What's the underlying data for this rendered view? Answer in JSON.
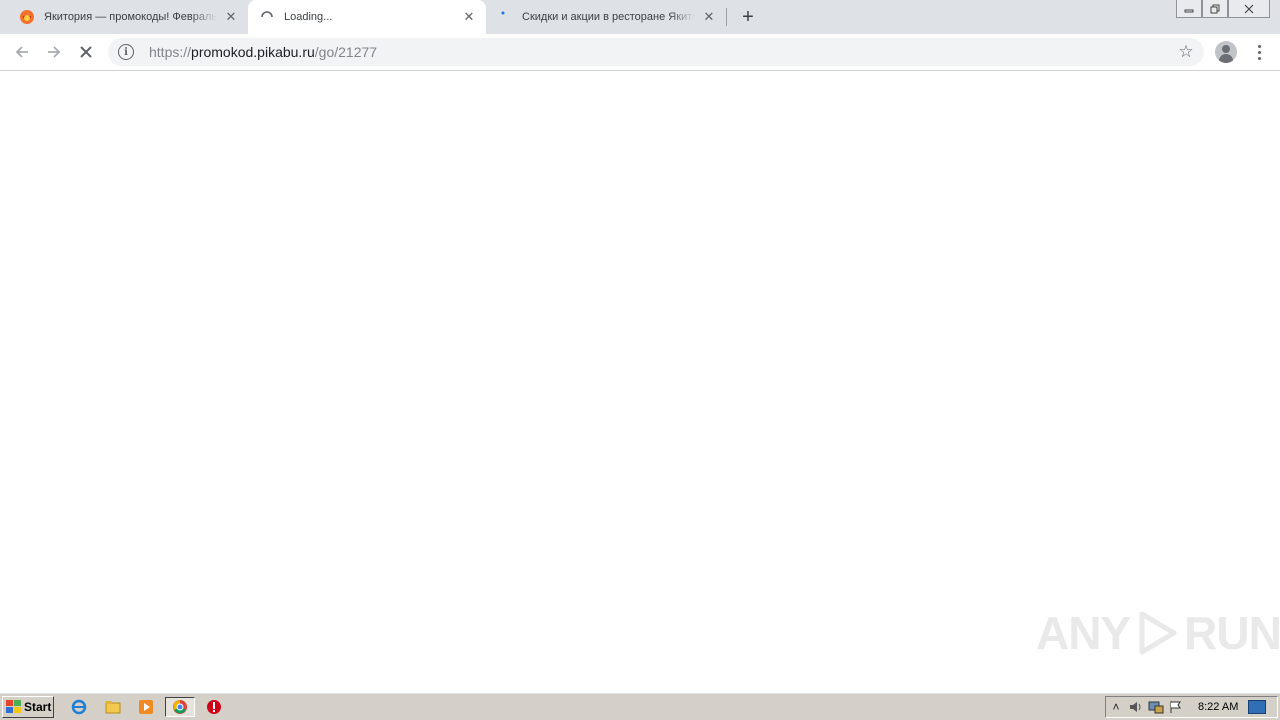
{
  "tabs": [
    {
      "title": "Якитория — промокоды! Февраль",
      "favicon": "pikabu-icon",
      "active": false
    },
    {
      "title": "Loading...",
      "favicon": "loading-spinner-icon",
      "active": true
    },
    {
      "title": "Скидки и акции в ресторане Якитория",
      "favicon": "loading-dot-icon",
      "active": false
    }
  ],
  "toolbar": {
    "url_scheme": "https://",
    "url_host": "promokod.pikabu.ru",
    "url_path": "/go/21277"
  },
  "watermark": {
    "left": "ANY",
    "right": "RUN"
  },
  "taskbar": {
    "start_label": "Start",
    "clock": "8:22 AM"
  },
  "colors": {
    "tabstrip_bg": "#dee1e6",
    "omnibox_bg": "#f1f3f4",
    "taskbar_bg": "#d4d0c8"
  }
}
